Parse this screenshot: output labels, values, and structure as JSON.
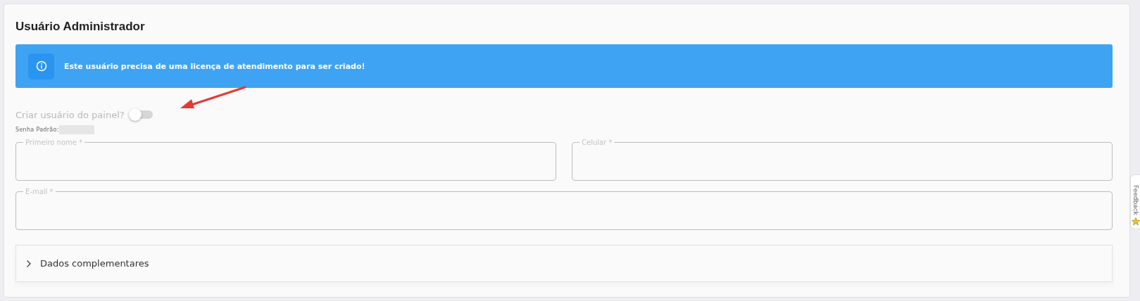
{
  "section": {
    "title": "Usuário Administrador"
  },
  "alert": {
    "message": "Este usuário precisa de uma licença de atendimento para ser criado!"
  },
  "toggle": {
    "label": "Criar usuário do painel?",
    "on": false
  },
  "default_password": {
    "label": "Senha Padrão:"
  },
  "fields": [
    {
      "label": "Primeiro nome *"
    },
    {
      "label": "Celular *"
    },
    {
      "label": "E-mail *"
    }
  ],
  "expander": {
    "label": "Dados complementares",
    "expanded": false
  },
  "feedback_tab": {
    "label": "Feedback"
  }
}
